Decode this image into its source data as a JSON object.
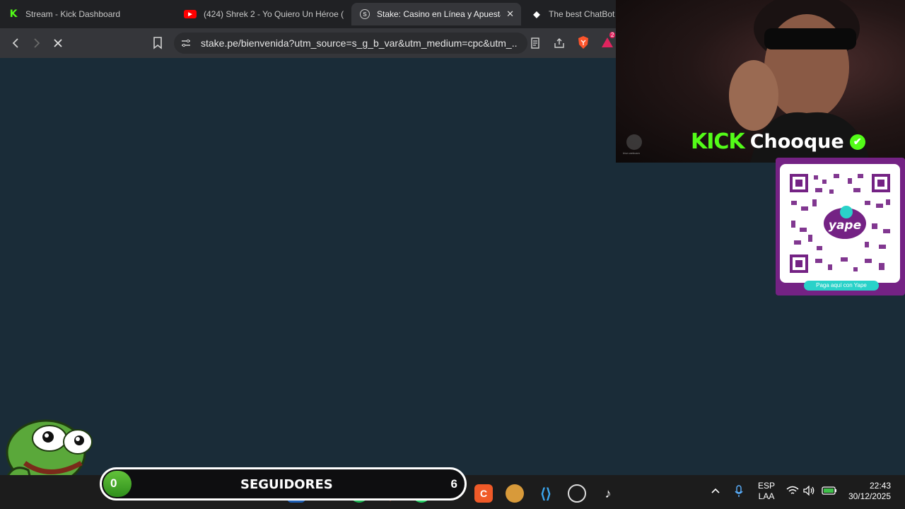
{
  "browser": {
    "tabs": [
      {
        "label": "Stream - Kick Dashboard",
        "icon": "kick-icon",
        "active": false
      },
      {
        "label": "(424) Shrek 2 - Yo Quiero Un Héroe (",
        "icon": "youtube-icon",
        "active": false
      },
      {
        "label": "Stake: Casino en Línea y Apuesta",
        "icon": "stake-icon",
        "active": true
      },
      {
        "label": "The best ChatBot",
        "icon": "chatbot-icon",
        "active": false
      }
    ],
    "tab_close": "✕",
    "url": "stake.pe/bienvenida?utm_source=s_g_b_var&utm_medium=cpc&utm_...",
    "brave_badge": "2"
  },
  "overlay": {
    "kick_logo": "KICK",
    "streamer": "Chooque",
    "yape_button": "Paga aquí con Yape",
    "yape_logo": "yape",
    "webcam_caption": "Iriun webcam"
  },
  "followers": {
    "current": "0",
    "label": "SEGUIDORES",
    "goal": "6",
    "progress": 0
  },
  "taskbar": {
    "lang_line1": "ESP",
    "lang_line2": "LAA",
    "time": "22:43",
    "date": "30/12/2025"
  },
  "colors": {
    "kick_green": "#53fc18",
    "stake_bg": "#1a2c38",
    "yape_purple": "#742284",
    "yape_teal": "#2ad2c9"
  }
}
